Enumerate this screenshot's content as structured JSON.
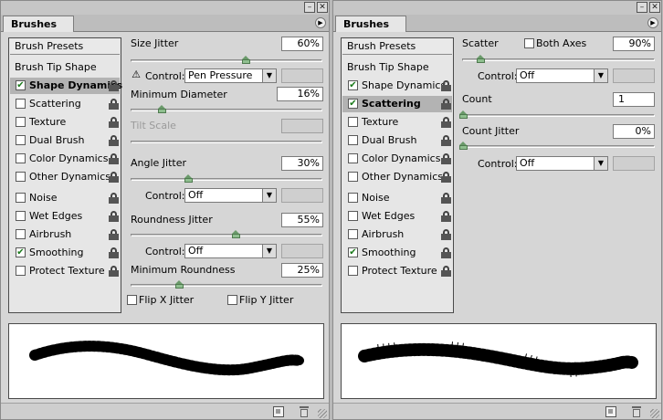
{
  "left_panel": {
    "tab": "Brushes",
    "list": {
      "presets": "Brush Presets",
      "tip_shape": "Brush Tip Shape",
      "items": [
        {
          "label": "Shape Dynamics",
          "checked": "✔"
        },
        {
          "label": "Scattering",
          "checked": ""
        },
        {
          "label": "Texture",
          "checked": ""
        },
        {
          "label": "Dual Brush",
          "checked": ""
        },
        {
          "label": "Color Dynamics",
          "checked": ""
        },
        {
          "label": "Other Dynamics",
          "checked": ""
        },
        {
          "label": "Noise",
          "checked": ""
        },
        {
          "label": "Wet Edges",
          "checked": ""
        },
        {
          "label": "Airbrush",
          "checked": ""
        },
        {
          "label": "Smoothing",
          "checked": "✔"
        },
        {
          "label": "Protect Texture",
          "checked": ""
        }
      ]
    },
    "size_jitter": {
      "label": "Size Jitter",
      "value": "60%"
    },
    "size_control": {
      "label": "Control:",
      "value": "Pen Pressure"
    },
    "min_diameter": {
      "label": "Minimum Diameter",
      "value": "16%"
    },
    "tilt_scale": {
      "label": "Tilt Scale"
    },
    "angle_jitter": {
      "label": "Angle Jitter",
      "value": "30%"
    },
    "angle_control": {
      "label": "Control:",
      "value": "Off"
    },
    "roundness_jitter": {
      "label": "Roundness Jitter",
      "value": "55%"
    },
    "roundness_control": {
      "label": "Control:",
      "value": "Off"
    },
    "min_roundness": {
      "label": "Minimum Roundness",
      "value": "25%"
    },
    "flip_x": "Flip X Jitter",
    "flip_y": "Flip Y Jitter"
  },
  "right_panel": {
    "tab": "Brushes",
    "list": {
      "presets": "Brush Presets",
      "tip_shape": "Brush Tip Shape",
      "items": [
        {
          "label": "Shape Dynamics",
          "checked": "✔"
        },
        {
          "label": "Scattering",
          "checked": "✔"
        },
        {
          "label": "Texture",
          "checked": ""
        },
        {
          "label": "Dual Brush",
          "checked": ""
        },
        {
          "label": "Color Dynamics",
          "checked": ""
        },
        {
          "label": "Other Dynamics",
          "checked": ""
        },
        {
          "label": "Noise",
          "checked": ""
        },
        {
          "label": "Wet Edges",
          "checked": ""
        },
        {
          "label": "Airbrush",
          "checked": ""
        },
        {
          "label": "Smoothing",
          "checked": "✔"
        },
        {
          "label": "Protect Texture",
          "checked": ""
        }
      ]
    },
    "scatter": {
      "label": "Scatter",
      "both_axes": "Both Axes",
      "value": "90%"
    },
    "scatter_control": {
      "label": "Control:",
      "value": "Off"
    },
    "count": {
      "label": "Count",
      "value": "1"
    },
    "count_jitter": {
      "label": "Count Jitter",
      "value": "0%"
    },
    "count_control": {
      "label": "Control:",
      "value": "Off"
    }
  },
  "icons": {
    "minimize": "minimize-icon",
    "close": "close-icon",
    "panel_menu": "panel-menu-icon",
    "lock": "lock-icon",
    "warning": "warning-icon",
    "new_preset": "new-preset-icon",
    "trash": "trash-icon"
  },
  "colors": {
    "panel_bg": "#d6d6d6",
    "list_active": "#b3b3b3",
    "slider_thumb": "#8fbf8f"
  }
}
